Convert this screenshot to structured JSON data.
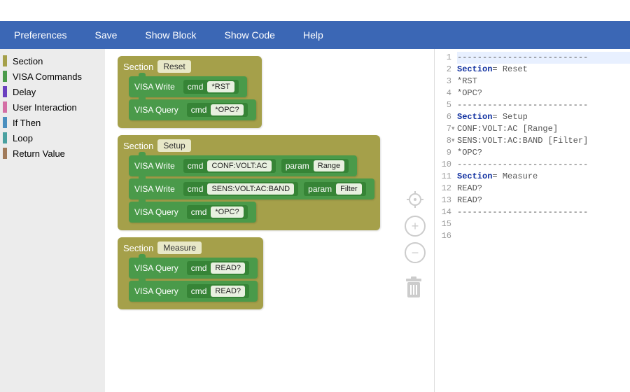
{
  "menu": {
    "items": [
      "Preferences",
      "Save",
      "Show Block",
      "Show Code",
      "Help"
    ]
  },
  "sidebar": [
    {
      "label": "Section",
      "color": "#a5a04a"
    },
    {
      "label": "VISA Commands",
      "color": "#4a9a4a"
    },
    {
      "label": "Delay",
      "color": "#6a3fbf"
    },
    {
      "label": "User Interaction",
      "color": "#d46fa5"
    },
    {
      "label": "If Then",
      "color": "#4a8fbf"
    },
    {
      "label": "Loop",
      "color": "#4aa0a0"
    },
    {
      "label": "Return Value",
      "color": "#a07a5a"
    }
  ],
  "sections": [
    {
      "name": "Reset",
      "rows": [
        {
          "type": "VISA Write",
          "cmd": "*RST"
        },
        {
          "type": "VISA Query",
          "cmd": "*OPC?"
        }
      ]
    },
    {
      "name": "Setup",
      "rows": [
        {
          "type": "VISA Write",
          "cmd": "CONF:VOLT:AC",
          "param": "Range"
        },
        {
          "type": "VISA Write",
          "cmd": "SENS:VOLT:AC:BAND",
          "param": "Filter"
        },
        {
          "type": "VISA Query",
          "cmd": "*OPC?"
        }
      ]
    },
    {
      "name": "Measure",
      "rows": [
        {
          "type": "VISA Query",
          "cmd": "READ?"
        },
        {
          "type": "VISA Query",
          "cmd": "READ?"
        }
      ]
    }
  ],
  "labels": {
    "section": "Section",
    "cmd": "cmd",
    "param": "param"
  },
  "code": {
    "dashes": "--------------------------",
    "sectionKw": "Section",
    "lines": [
      {
        "section": "Reset"
      },
      {
        "t": "*RST"
      },
      {
        "t": "*OPC?"
      },
      {
        "section": "Setup"
      },
      {
        "t": "CONF:VOLT:AC [Range]",
        "fold": true
      },
      {
        "t": "SENS:VOLT:AC:BAND [Filter]",
        "fold": true
      },
      {
        "t": "*OPC?"
      },
      {
        "section": "Measure"
      },
      {
        "t": "READ?"
      },
      {
        "t": "READ?"
      }
    ],
    "total_lines": 16
  }
}
